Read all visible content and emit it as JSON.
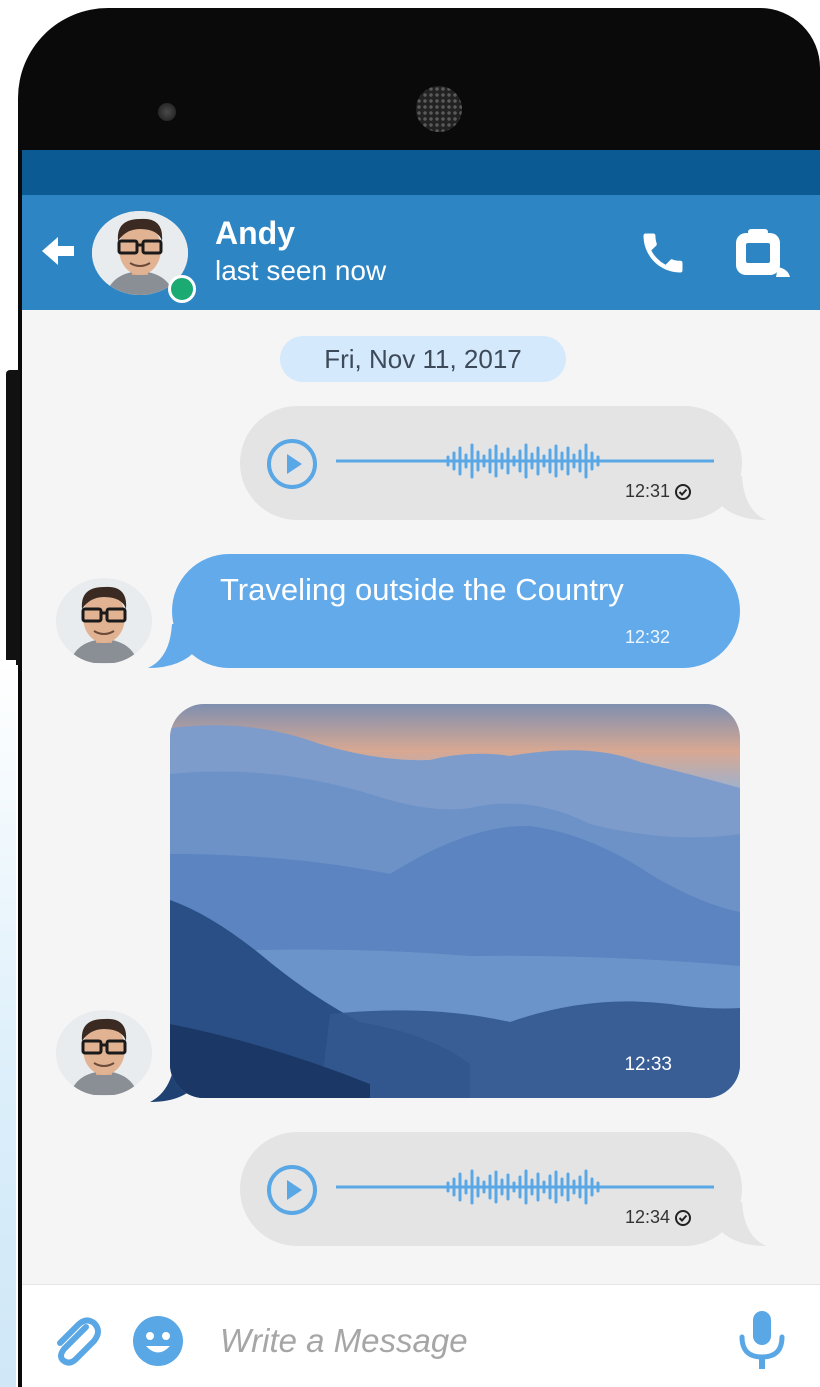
{
  "header": {
    "contact_name": "Andy",
    "contact_status": "last seen now",
    "online": true
  },
  "conversation": {
    "date_divider": "Fri, Nov 11, 2017",
    "messages": [
      {
        "type": "voice",
        "direction": "outgoing",
        "time": "12:31",
        "status": "read"
      },
      {
        "type": "text",
        "direction": "incoming",
        "text": "Traveling outside the Country",
        "time": "12:32"
      },
      {
        "type": "image",
        "direction": "incoming",
        "image_name": "misty-mountains-photo",
        "time": "12:33"
      },
      {
        "type": "voice",
        "direction": "outgoing",
        "time": "12:34",
        "status": "read"
      }
    ]
  },
  "composer": {
    "placeholder": "Write a Message"
  },
  "icons": {
    "back": "arrow-left-icon",
    "call": "phone-icon",
    "delete": "trash-icon",
    "attach": "paperclip-icon",
    "emoji": "smiley-icon",
    "mic": "microphone-icon",
    "play": "play-icon",
    "read": "check-circle-icon"
  },
  "colors": {
    "status_bar": "#0b5a94",
    "app_bar": "#2e85c3",
    "incoming_bubble": "#63aaeb",
    "outgoing_bubble": "#e4e4e4",
    "accent": "#5aa7e6",
    "online": "#1aaa72"
  }
}
